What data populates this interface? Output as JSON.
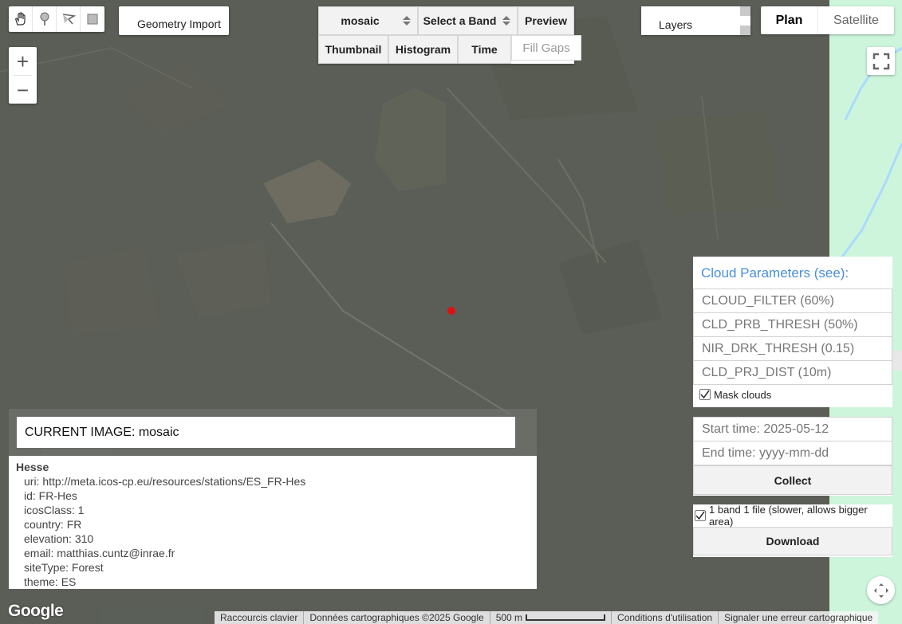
{
  "colors": {
    "accent_blue": "#4a8fd8",
    "marker_red": "#e01010",
    "satellite_bg": "#62675e",
    "plan_green": "#cdf5dc"
  },
  "draw_tools": {
    "icons": [
      "hand-icon",
      "point-icon",
      "line-icon",
      "rectangle-icon"
    ]
  },
  "geometry": {
    "label": "Geometry Import"
  },
  "zoom": {
    "in": "+",
    "out": "−"
  },
  "toolbar": {
    "image_select": "mosaic",
    "band_select": "Select a Band",
    "preview": "Preview",
    "thumbnail": "Thumbnail",
    "histogram": "Histogram",
    "time": "Time",
    "fill_gaps": "Fill Gaps"
  },
  "layers": {
    "label": "Layers"
  },
  "map_type": {
    "plan": "Plan",
    "satellite": "Satellite"
  },
  "cloud_panel": {
    "title": "Cloud Parameters (see):",
    "params": [
      "CLOUD_FILTER (60%)",
      "CLD_PRB_THRESH (50%)",
      "NIR_DRK_THRESH (0.15)",
      "CLD_PRJ_DIST (10m)"
    ],
    "mask_label": "Mask clouds",
    "mask_checked": true
  },
  "time_panel": {
    "start_placeholder": "Start time: 2025-05-12",
    "end_placeholder": "End time: yyyy-mm-dd",
    "collect": "Collect"
  },
  "download_panel": {
    "band_label": "1 band 1 file (slower, allows bigger area)",
    "band_checked": true,
    "download": "Download"
  },
  "current_image": {
    "label": "CURRENT IMAGE: mosaic"
  },
  "info": {
    "site": "Hesse",
    "props": [
      "uri: http://meta.icos-cp.eu/resources/stations/ES_FR-Hes",
      "id: FR-Hes",
      "icosClass: 1",
      "country: FR",
      "elevation: 310",
      "email: matthias.cuntz@inrae.fr",
      "siteType: Forest",
      "theme: ES"
    ]
  },
  "footer": {
    "google": "Google",
    "shortcuts": "Raccourcis clavier",
    "map_data": "Données cartographiques ©2025 Google",
    "scale": "500 m",
    "terms": "Conditions d'utilisation",
    "report": "Signaler une erreur cartographique"
  }
}
